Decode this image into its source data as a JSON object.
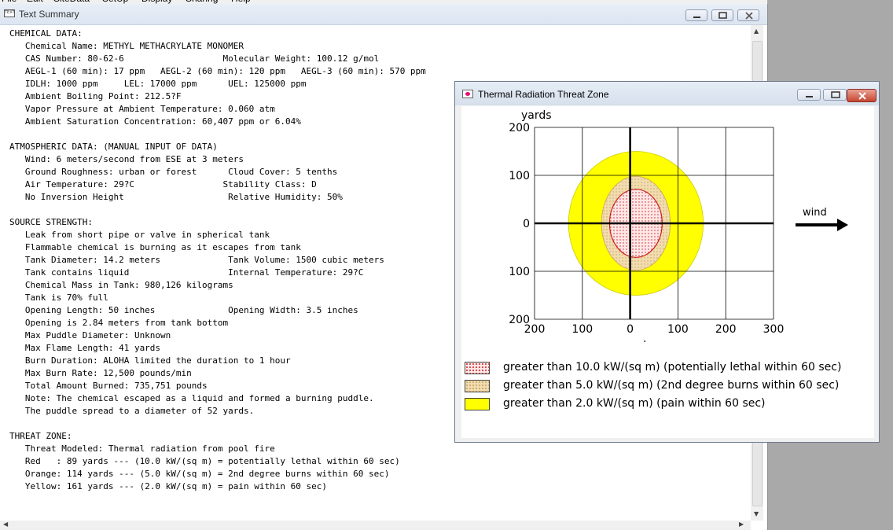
{
  "menu": [
    "File",
    "Edit",
    "SiteData",
    "SetUp",
    "Display",
    "Sharing",
    "Help"
  ],
  "summary_window": {
    "title": "Text Summary",
    "lines": [
      "CHEMICAL DATA:",
      "   Chemical Name: METHYL METHACRYLATE MONOMER",
      "   CAS Number: 80-62-6                   Molecular Weight: 100.12 g/mol",
      "   AEGL-1 (60 min): 17 ppm   AEGL-2 (60 min): 120 ppm   AEGL-3 (60 min): 570 ppm",
      "   IDLH: 1000 ppm     LEL: 17000 ppm      UEL: 125000 ppm",
      "   Ambient Boiling Point: 212.5?F",
      "   Vapor Pressure at Ambient Temperature: 0.060 atm",
      "   Ambient Saturation Concentration: 60,407 ppm or 6.04%",
      "",
      "ATMOSPHERIC DATA: (MANUAL INPUT OF DATA)",
      "   Wind: 6 meters/second from ESE at 3 meters",
      "   Ground Roughness: urban or forest      Cloud Cover: 5 tenths",
      "   Air Temperature: 29?C                 Stability Class: D",
      "   No Inversion Height                    Relative Humidity: 50%",
      "",
      "SOURCE STRENGTH:",
      "   Leak from short pipe or valve in spherical tank",
      "   Flammable chemical is burning as it escapes from tank",
      "   Tank Diameter: 14.2 meters             Tank Volume: 1500 cubic meters",
      "   Tank contains liquid                   Internal Temperature: 29?C",
      "   Chemical Mass in Tank: 980,126 kilograms",
      "   Tank is 70% full",
      "   Opening Length: 50 inches              Opening Width: 3.5 inches",
      "   Opening is 2.84 meters from tank bottom",
      "   Max Puddle Diameter: Unknown",
      "   Max Flame Length: 41 yards",
      "   Burn Duration: ALOHA limited the duration to 1 hour",
      "   Max Burn Rate: 12,500 pounds/min",
      "   Total Amount Burned: 735,751 pounds",
      "   Note: The chemical escaped as a liquid and formed a burning puddle.",
      "   The puddle spread to a diameter of 52 yards.",
      "",
      "THREAT ZONE:",
      "   Threat Modeled: Thermal radiation from pool fire",
      "   Red   : 89 yards --- (10.0 kW/(sq m) = potentially lethal within 60 sec)",
      "   Orange: 114 yards --- (5.0 kW/(sq m) = 2nd degree burns within 60 sec)",
      "   Yellow: 161 yards --- (2.0 kW/(sq m) = pain within 60 sec)"
    ]
  },
  "threat_window": {
    "title": "Thermal Radiation Threat Zone",
    "wind_label": "wind"
  },
  "chart_data": {
    "type": "area",
    "title": "",
    "xlabel": "yards",
    "ylabel": "yards",
    "xlim": [
      -200,
      300
    ],
    "ylim": [
      -200,
      200
    ],
    "x_ticks": [
      -200,
      -100,
      0,
      100,
      200,
      300
    ],
    "x_tick_labels": [
      "200",
      "100",
      "0",
      "100",
      "200",
      "300"
    ],
    "y_ticks": [
      200,
      100,
      0,
      -100,
      -200
    ],
    "y_tick_labels": [
      "200",
      "100",
      "0",
      "100",
      "200"
    ],
    "grid": true,
    "legend_placement": "bottom",
    "zones": [
      {
        "name": "greater than 2.0 kW/(sq m) (pain within 60 sec)",
        "color": "#ffff00",
        "pattern": "solid",
        "radius_x": 141,
        "radius_y": 150,
        "center": [
          12,
          0
        ]
      },
      {
        "name": "greater than 5.0 kW/(sq m) (2nd degree burns within 60 sec)",
        "color": "#f1dcb0",
        "pattern": "dots",
        "dot_color": "#c9a05a",
        "radius_x": 72,
        "radius_y": 98,
        "center": [
          12,
          0
        ]
      },
      {
        "name": "greater than 10.0 kW/(sq m) (potentially lethal within 60 sec)",
        "color": "#ffe6e6",
        "pattern": "dots",
        "dot_color": "#c81e1e",
        "radius_x": 55,
        "radius_y": 71,
        "center": [
          12,
          0
        ]
      }
    ],
    "legend_order": [
      2,
      1,
      0
    ],
    "wind_direction": "east"
  }
}
